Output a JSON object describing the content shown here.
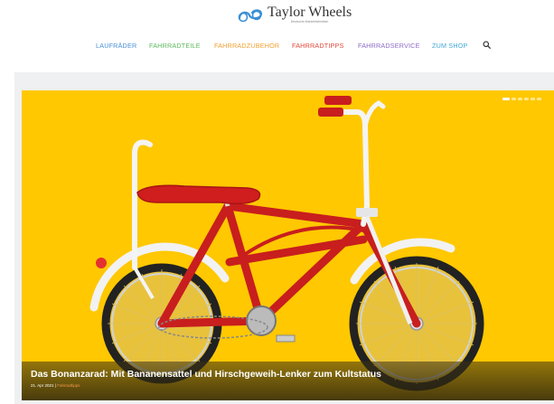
{
  "site": {
    "name": "Taylor Wheels",
    "tagline": "Deutsche Markenfahrräder"
  },
  "nav": {
    "items": [
      {
        "label": "LAUFRÄDER",
        "color": "#4a90d9"
      },
      {
        "label": "FAHRRADTEILE",
        "color": "#5cb85c"
      },
      {
        "label": "FAHRRADZUBEHÖR",
        "color": "#f0a030"
      },
      {
        "label": "FAHRRADTIPPS",
        "color": "#e0493a"
      },
      {
        "label": "FAHRRADSERVICE",
        "color": "#8e6ac8"
      },
      {
        "label": "ZUM SHOP",
        "color": "#3fa9d6"
      }
    ],
    "search_icon": "search-icon"
  },
  "slider": {
    "background_color": "#ffc800",
    "active_slide": 1,
    "slide_count": 6,
    "post": {
      "title": "Das Bonanzarad: Mit Bananensattel und Hirschgeweih-Lenker zum Kultstatus",
      "date": "21. Apr 2021",
      "separator": "|",
      "category": "Fahrradtipps"
    }
  }
}
